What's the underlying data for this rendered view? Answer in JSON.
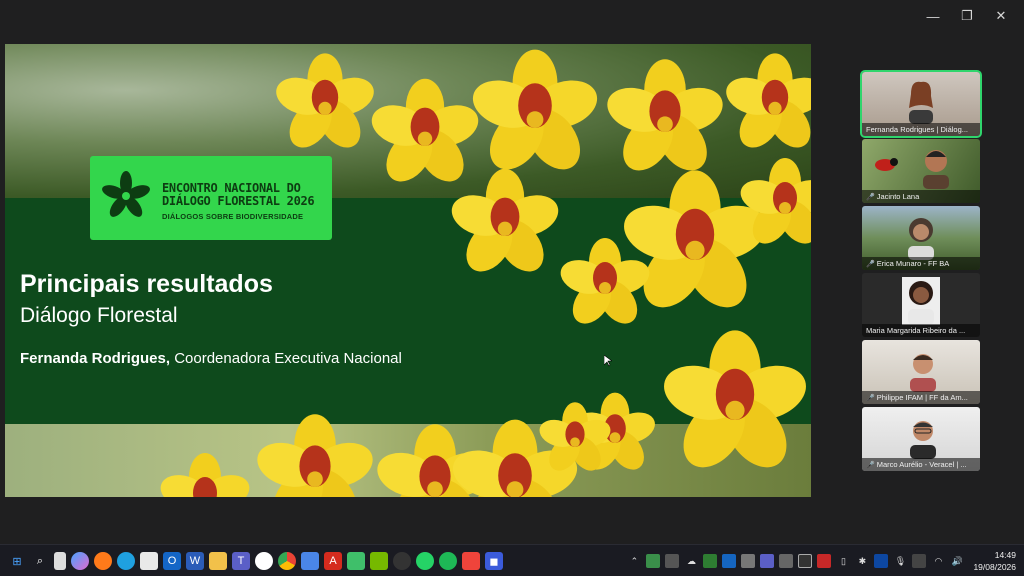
{
  "window_controls": {
    "minimize": "—",
    "restore": "❐",
    "close": "✕"
  },
  "slide": {
    "badge_title_line1": "ENCONTRO NACIONAL DO",
    "badge_title_line2": "DIÁLOGO FLORESTAL 2026",
    "badge_subtitle": "DIÁLOGOS SOBRE BIODIVERSIDADE",
    "title": "Principais resultados",
    "subtitle": "Diálogo Florestal",
    "author_name": "Fernanda Rodrigues,",
    "author_role": " Coordenadora Executiva Nacional",
    "colors": {
      "band": "#0e4a1c",
      "badge": "#33d64c",
      "flower": "#f2cf1e",
      "flower_center": "#b5331b"
    }
  },
  "participants": [
    {
      "name": "Fernanda Rodrigues | Diálog...",
      "muted": false,
      "active": true
    },
    {
      "name": "Jacinto Lana",
      "muted": true,
      "active": false
    },
    {
      "name": "Erica Munaro - FF BA",
      "muted": true,
      "active": false
    },
    {
      "name": "Maria Margarida Ribeiro da ...",
      "muted": false,
      "active": false
    },
    {
      "name": "Philippe IFAM | FF da Am...",
      "muted": true,
      "active": false
    },
    {
      "name": "Marco Aurélio - Veracel | ...",
      "muted": true,
      "active": false
    }
  ],
  "taskbar": {
    "apps": [
      "start-icon",
      "search-icon",
      "file-icon",
      "copilot-icon",
      "firefox-icon",
      "edge-icon",
      "store-icon",
      "outlook-icon",
      "word-icon",
      "explorer-icon",
      "teams-icon",
      "zoom-icon",
      "chrome-icon",
      "docs-icon",
      "pdf-icon",
      "vpn-icon",
      "nvidia-icon",
      "obs-icon",
      "whatsapp-icon",
      "whatsapp2-icon",
      "anydesk-icon",
      "meet-icon"
    ],
    "time": "14:49",
    "date": "19/08/2026"
  }
}
